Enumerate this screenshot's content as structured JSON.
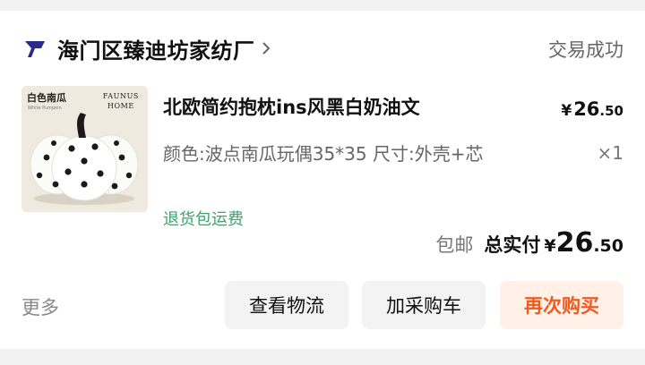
{
  "shop": {
    "name": "海门区臻迪坊家纺厂",
    "logo_icon": "shop-logo-icon",
    "chevron_icon": "chevron-right-icon"
  },
  "order": {
    "status": "交易成功",
    "item": {
      "title": "北欧简约抱枕ins风黑白奶油文",
      "price_currency": "¥",
      "price_int": "26",
      "price_dec": ".50",
      "spec": "颜色:波点南瓜玩偶35*35 尺寸:外壳+芯",
      "quantity": "×1",
      "tag": "退货包运费",
      "thumbnail": {
        "label_cn": "白色南瓜",
        "label_en": "White Pumpkin",
        "brand_line1": "FAUNUS",
        "brand_line2": "HOME"
      }
    },
    "total": {
      "shipping": "包邮",
      "label": "总实付",
      "currency": "¥",
      "int": "26",
      "dec": ".50"
    }
  },
  "actions": {
    "more": "更多",
    "logistics": "查看物流",
    "add_cart": "加采购车",
    "rebuy": "再次购买"
  },
  "colors": {
    "accent": "#f05a1e",
    "tag_green": "#3aa56a",
    "logo": "#2a2a8c"
  }
}
